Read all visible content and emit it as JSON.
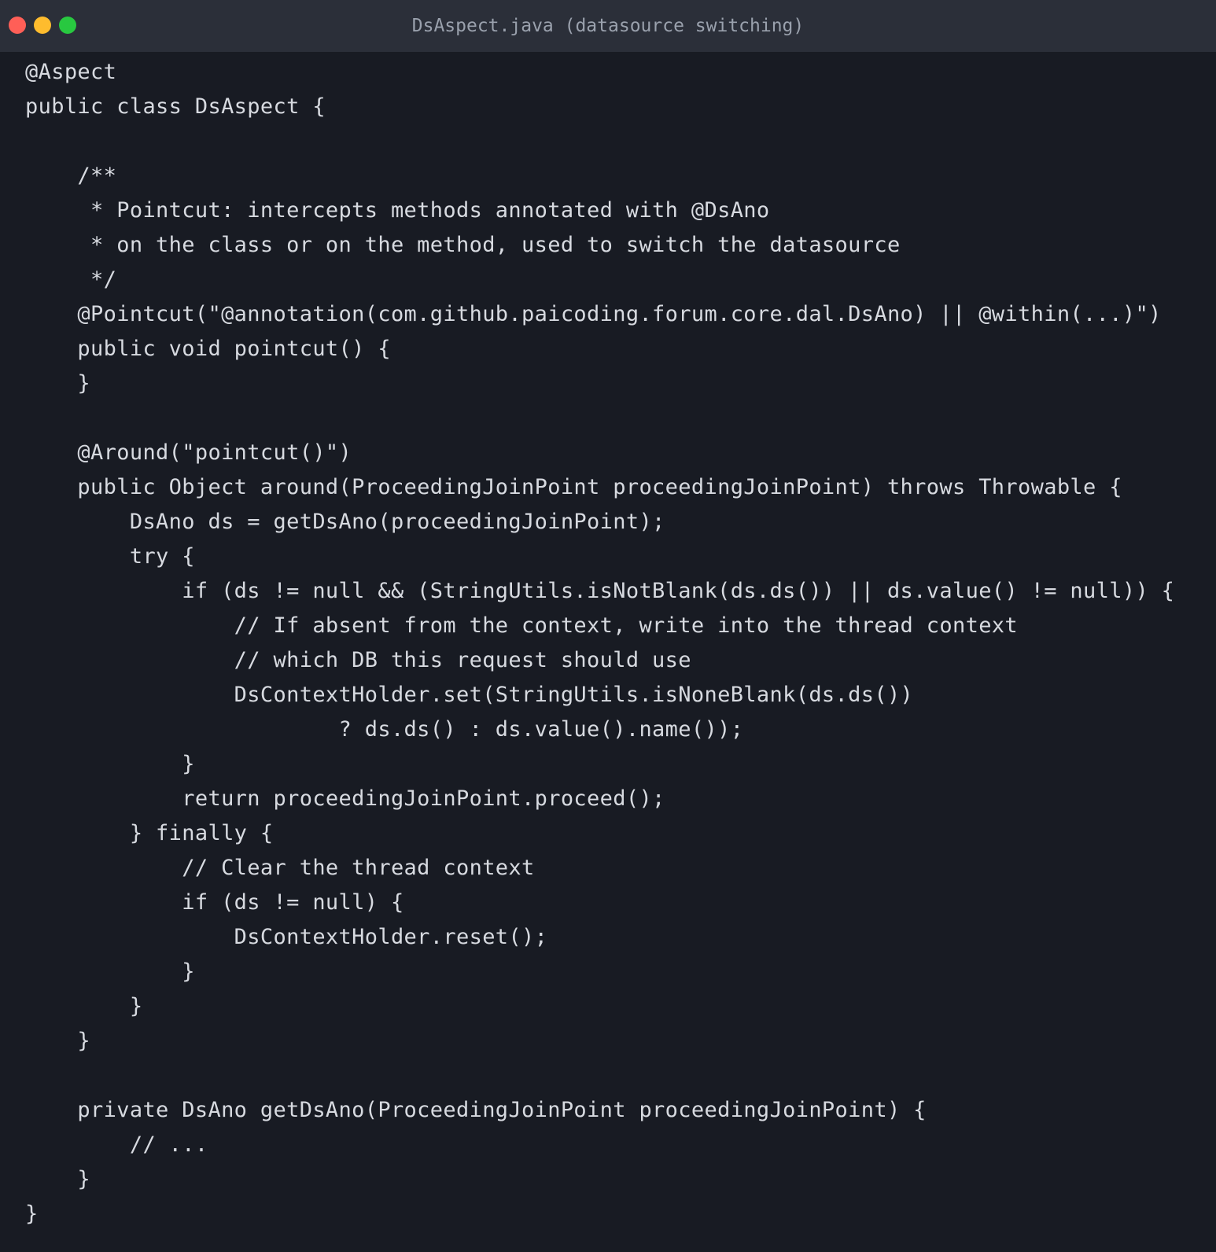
{
  "window": {
    "title": "DsAspect.java (datasource switching)",
    "controls": [
      "close",
      "minimize",
      "maximize"
    ]
  },
  "colors": {
    "background": "#181b23",
    "titlebar": "#2b2f39",
    "text": "#d7dae0",
    "close": "#ff5f57",
    "minimize": "#febc2e",
    "maximize": "#28c840"
  },
  "code": {
    "language": "java",
    "lines": [
      "@Aspect",
      "public class DsAspect {",
      "",
      "    /**",
      "     * Pointcut: intercepts methods annotated with @DsAno",
      "     * on the class or on the method, used to switch the datasource",
      "     */",
      "    @Pointcut(\"@annotation(com.github.paicoding.forum.core.dal.DsAno) || @within(...)\")",
      "    public void pointcut() {",
      "    }",
      "",
      "    @Around(\"pointcut()\")",
      "    public Object around(ProceedingJoinPoint proceedingJoinPoint) throws Throwable {",
      "        DsAno ds = getDsAno(proceedingJoinPoint);",
      "        try {",
      "            if (ds != null && (StringUtils.isNotBlank(ds.ds()) || ds.value() != null)) {",
      "                // If absent from the context, write into the thread context",
      "                // which DB this request should use",
      "                DsContextHolder.set(StringUtils.isNoneBlank(ds.ds())",
      "                        ? ds.ds() : ds.value().name());",
      "            }",
      "            return proceedingJoinPoint.proceed();",
      "        } finally {",
      "            // Clear the thread context",
      "            if (ds != null) {",
      "                DsContextHolder.reset();",
      "            }",
      "        }",
      "    }",
      "",
      "    private DsAno getDsAno(ProceedingJoinPoint proceedingJoinPoint) {",
      "        // ...",
      "    }",
      "}"
    ]
  }
}
